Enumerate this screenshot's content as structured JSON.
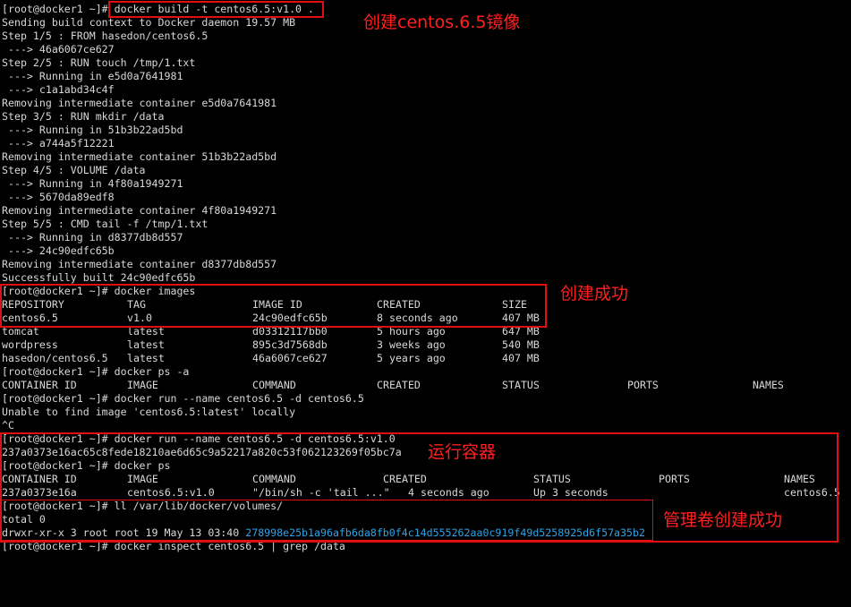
{
  "terminal": {
    "lines": [
      "[root@docker1 ~]# docker build -t centos6.5:v1.0 .",
      "Sending build context to Docker daemon 19.57 MB",
      "Step 1/5 : FROM hasedon/centos6.5",
      " ---> 46a6067ce627",
      "Step 2/5 : RUN touch /tmp/1.txt",
      " ---> Running in e5d0a7641981",
      " ---> c1a1abd34c4f",
      "Removing intermediate container e5d0a7641981",
      "Step 3/5 : RUN mkdir /data",
      " ---> Running in 51b3b22ad5bd",
      " ---> a744a5f12221",
      "Removing intermediate container 51b3b22ad5bd",
      "Step 4/5 : VOLUME /data",
      " ---> Running in 4f80a1949271",
      " ---> 5670da89edf8",
      "Removing intermediate container 4f80a1949271",
      "Step 5/5 : CMD tail -f /tmp/1.txt",
      " ---> Running in d8377db8d557",
      " ---> 24c90edfc65b",
      "Removing intermediate container d8377db8d557",
      "Successfully built 24c90edfc65b",
      "[root@docker1 ~]# docker images"
    ],
    "images_table": {
      "headers": [
        "REPOSITORY",
        "TAG",
        "IMAGE ID",
        "CREATED",
        "SIZE"
      ],
      "rows": [
        [
          "centos6.5",
          "v1.0",
          "24c90edfc65b",
          "8 seconds ago",
          "407 MB"
        ],
        [
          "tomcat",
          "latest",
          "d03312117bb0",
          "5 hours ago",
          "647 MB"
        ],
        [
          "wordpress",
          "latest",
          "895c3d7568db",
          "3 weeks ago",
          "540 MB"
        ],
        [
          "hasedon/centos6.5",
          "latest",
          "46a6067ce627",
          "5 years ago",
          "407 MB"
        ]
      ]
    },
    "ps_a_cmd": "[root@docker1 ~]# docker ps -a",
    "ps_headers": [
      "CONTAINER ID",
      "IMAGE",
      "COMMAND",
      "CREATED",
      "STATUS",
      "PORTS",
      "NAMES"
    ],
    "run_fail_lines": [
      "[root@docker1 ~]# docker run --name centos6.5 -d centos6.5",
      "Unable to find image 'centos6.5:latest' locally",
      "^C"
    ],
    "run_ok_lines": [
      "[root@docker1 ~]# docker run --name centos6.5 -d centos6.5:v1.0",
      "237a0373e16ac65c8fede18210ae6d65c9a52217a820c53f062123269f05bc7a",
      "[root@docker1 ~]# docker ps"
    ],
    "ps_row": [
      "237a0373e16a",
      "centos6.5:v1.0",
      "\"/bin/sh -c 'tail ...\"",
      "4 seconds ago",
      "Up 3 seconds",
      "",
      "centos6.5"
    ],
    "volume_lines": [
      "[root@docker1 ~]# ll /var/lib/docker/volumes/",
      "total 0"
    ],
    "volume_entry": {
      "meta": "drwxr-xr-x 3 root root 19 May 13 03:40 ",
      "name": "278998e25b1a96afb6da8fb0f4c14d555262aa0c919f49d5258925d6f57a35b2"
    },
    "last_partial": "[root@docker1 ~]# docker inspect centos6.5 | grep /data"
  },
  "annotations": {
    "build": "创建centos.6.5镜像",
    "images": "创建成功",
    "run": "运行容器",
    "volume": "管理卷创建成功"
  },
  "colors": {
    "background": "#000000",
    "text": "#d8d8d8",
    "highlight": "#2ea3e6",
    "annotation": "#e01010"
  }
}
